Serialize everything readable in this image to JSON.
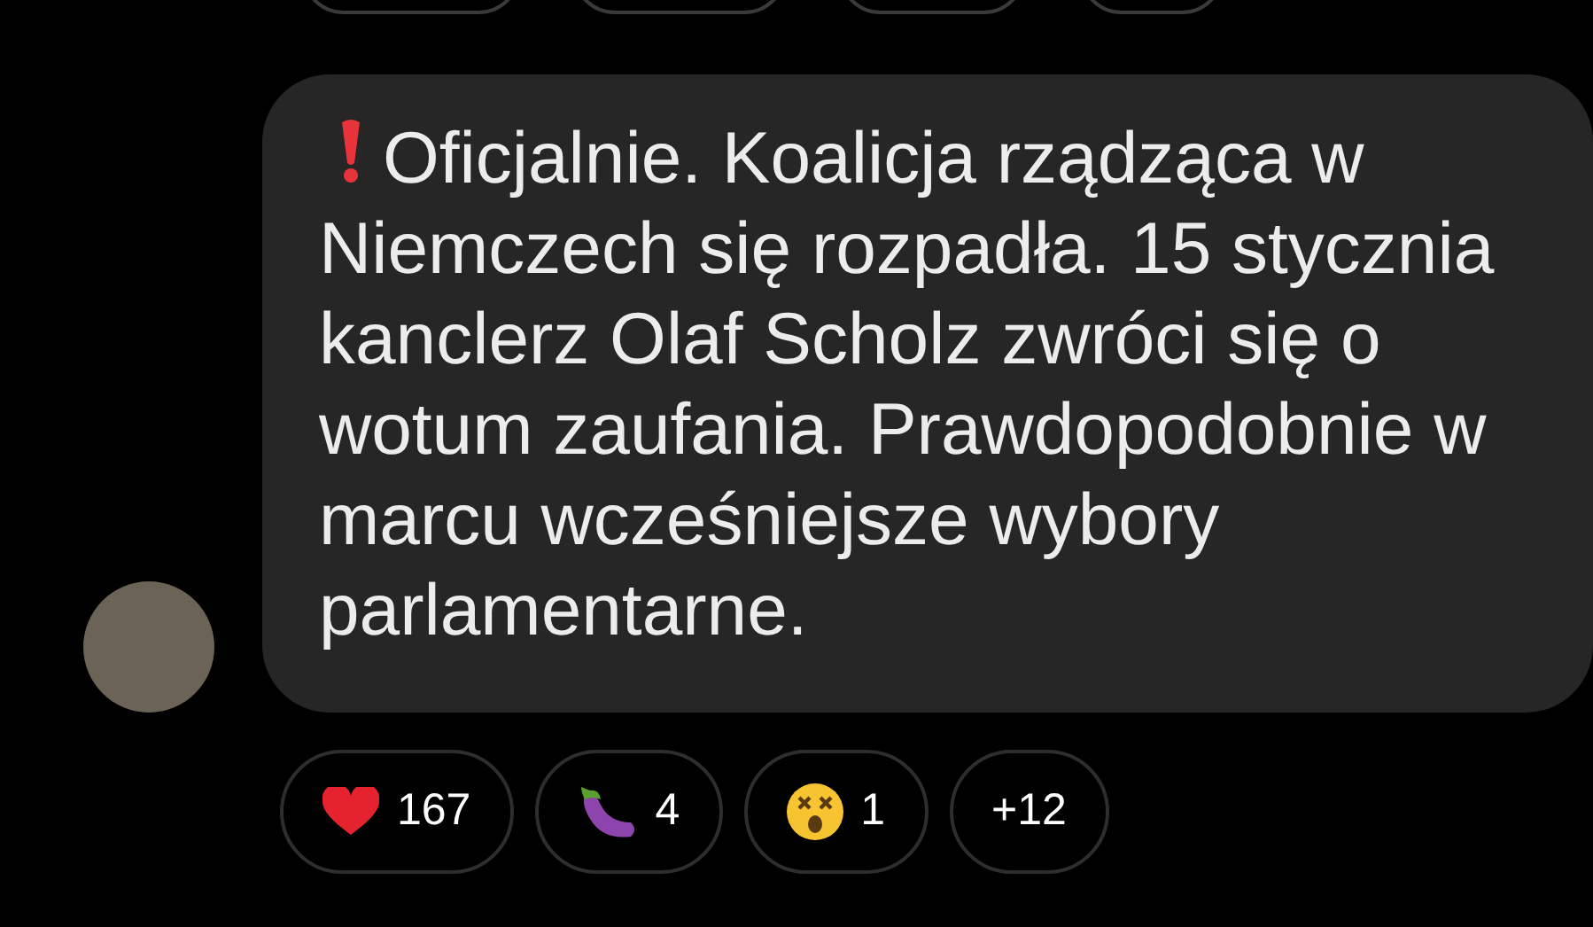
{
  "previous_reactions": [
    {
      "kind": "chip"
    },
    {
      "kind": "chip"
    },
    {
      "kind": "chip"
    },
    {
      "kind": "chip"
    }
  ],
  "message": {
    "text": "Oficjalnie. Koalicja rządząca w Niemczech się rozpadła. 15 stycznia kanclerz Olaf Scholz zwróci się o wotum zaufania. Prawdopodobnie w marcu wcześniejsze wybory parlamentarne."
  },
  "reactions": [
    {
      "kind": "heart",
      "count": "167"
    },
    {
      "kind": "eggplant",
      "count": "4"
    },
    {
      "kind": "dizzy_face",
      "count": "1"
    },
    {
      "kind": "more",
      "count": "+12"
    }
  ]
}
